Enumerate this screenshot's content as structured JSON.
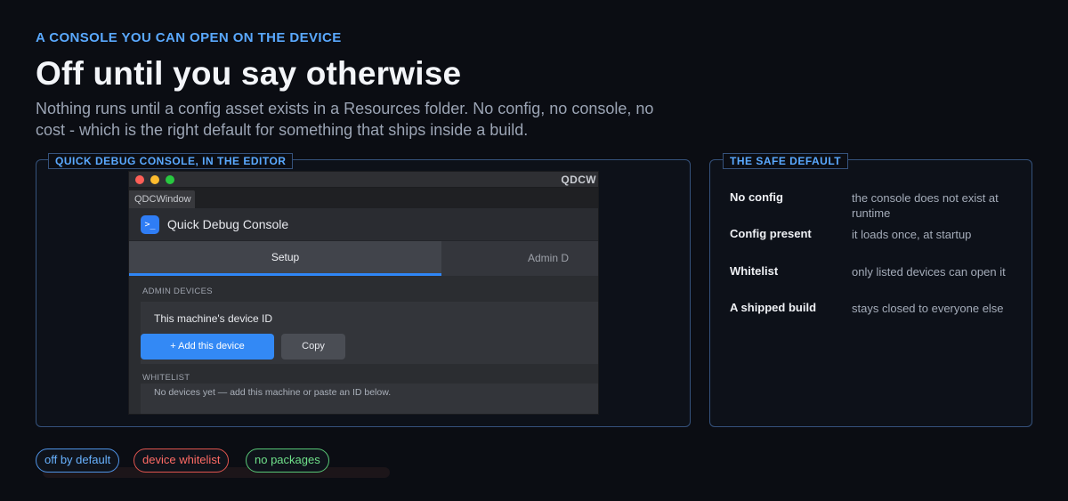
{
  "hero": {
    "eyebrow": "A CONSOLE YOU CAN OPEN ON THE DEVICE",
    "title": "Off until you say otherwise",
    "subtitle": "Nothing runs until a config asset exists in a Resources folder. No config, no console, no cost - which is the right default for something that ships inside a build."
  },
  "editor_panel": {
    "label": "QUICK DEBUG CONSOLE, IN THE EDITOR",
    "window": {
      "title": "QDCW",
      "tab_label": "QDCWindow",
      "app_icon": ">_",
      "app_title": "Quick Debug Console",
      "tabs": [
        "Setup",
        "Admin D"
      ],
      "admin_devices_label": "ADMIN DEVICES",
      "device_id_label": "This machine's device ID",
      "add_button": "+ Add this device",
      "copy_button": "Copy",
      "whitelist_label": "WHITELIST",
      "whitelist_empty": "No devices yet — add this machine or paste an ID below."
    }
  },
  "safe_default": {
    "label": "THE SAFE DEFAULT",
    "rows": [
      {
        "key": "No config",
        "value": "the console does not exist at runtime"
      },
      {
        "key": "Config present",
        "value": "it loads once, at startup"
      },
      {
        "key": "Whitelist",
        "value": "only listed devices can open it"
      },
      {
        "key": "A shipped build",
        "value": "stays closed to everyone else"
      }
    ]
  },
  "pills": [
    "off by default",
    "device whitelist",
    "no packages"
  ],
  "colors": {
    "accent": "#5aa9ff",
    "primary_button": "#3389f5",
    "pill_blue": "#68b2ff",
    "pill_red": "#ff6b65",
    "pill_green": "#6fe08a"
  }
}
